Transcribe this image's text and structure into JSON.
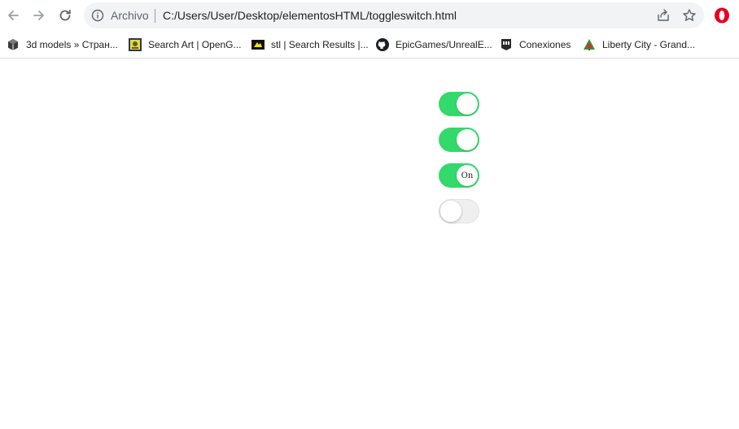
{
  "browser": {
    "site_label": "Archivo",
    "url": "C:/Users/User/Desktop/elementosHTML/toggleswitch.html",
    "accent_color": "#e8001c"
  },
  "bookmarks": [
    {
      "label": "3d models » Стран...",
      "icon": "cube-icon"
    },
    {
      "label": "Search Art | OpenG...",
      "icon": "opengameart-icon"
    },
    {
      "label": "stl | Search Results |...",
      "icon": "stl-icon"
    },
    {
      "label": "EpicGames/UnrealE...",
      "icon": "github-icon"
    },
    {
      "label": "Conexiones",
      "icon": "epic-games-icon"
    },
    {
      "label": "Liberty City - Grand...",
      "icon": "tree-icon"
    }
  ],
  "toggles": [
    {
      "state": "on",
      "label": ""
    },
    {
      "state": "on",
      "label": ""
    },
    {
      "state": "on",
      "label": "On"
    },
    {
      "state": "off",
      "label": ""
    }
  ],
  "colors": {
    "toggle_on": "#33d96b",
    "toggle_off": "#efefef"
  }
}
